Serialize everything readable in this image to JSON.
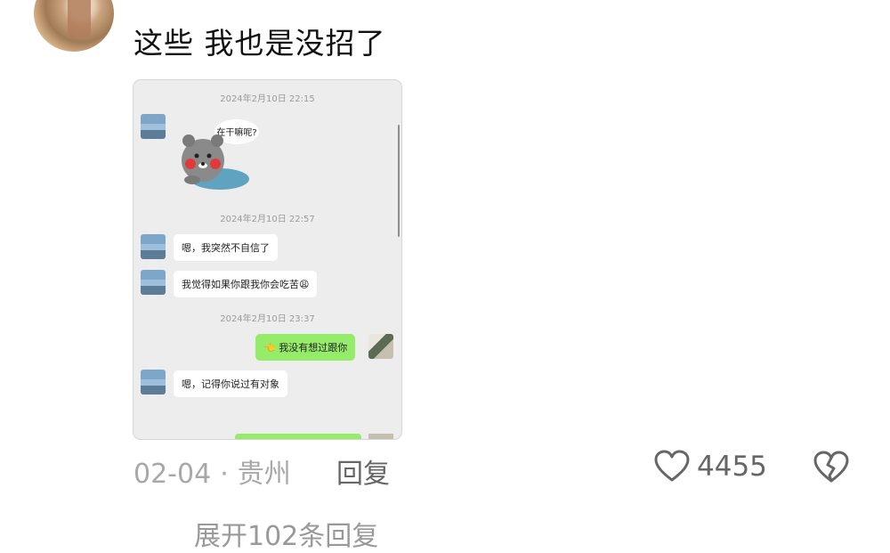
{
  "comment": {
    "text": "这些 我也是没招了",
    "date": "02-04",
    "separator": "·",
    "location": "贵州",
    "reply_label": "回复",
    "like_count": "4455",
    "more_replies": "展开102条回复"
  },
  "chat_screenshot": {
    "timestamps": [
      "2024年2月10日 22:15",
      "2024年2月10日 22:57",
      "2024年2月10日 23:37"
    ],
    "sticker_text": "在干嘛呢?",
    "messages": [
      {
        "side": "left",
        "text": "嗯，我突然不自信了"
      },
      {
        "side": "left",
        "text": "我觉得如果你跟我你会吃苦😩"
      },
      {
        "side": "right",
        "text": "👈 我没有想过跟你"
      },
      {
        "side": "left",
        "text": "嗯，记得你说过有对象"
      }
    ]
  },
  "icons": {
    "like": "heart-outline-icon",
    "dislike": "broken-heart-icon"
  }
}
